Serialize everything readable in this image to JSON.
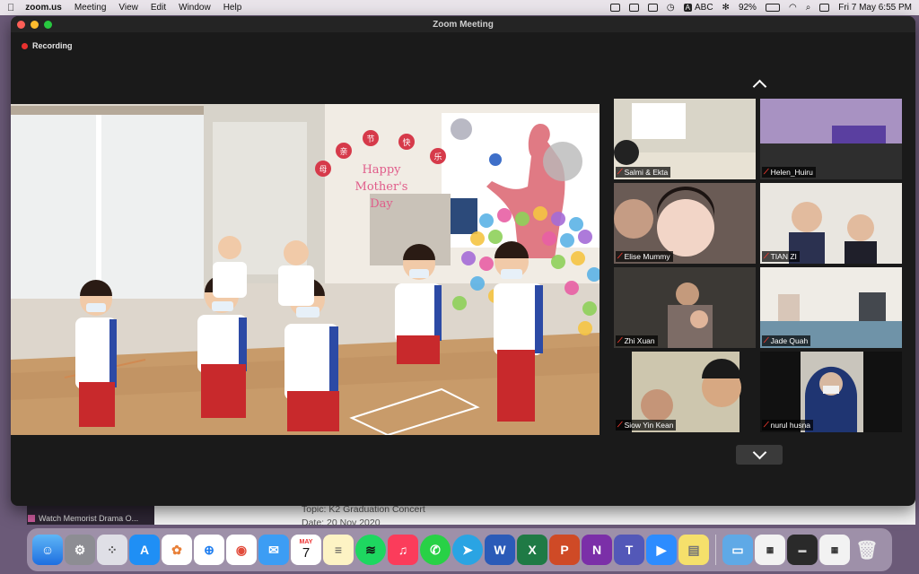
{
  "menubar": {
    "app": "zoom.us",
    "items": [
      "Meeting",
      "View",
      "Edit",
      "Window",
      "Help"
    ],
    "input_source": "ABC",
    "battery": "92%",
    "datetime": "Fri 7 May  6:55 PM"
  },
  "window": {
    "title": "Zoom Meeting",
    "recording_label": "Recording"
  },
  "main_video": {
    "banner": "Happy Mother's Day",
    "chinese_title": [
      "母",
      "亲",
      "节",
      "快",
      "乐"
    ]
  },
  "participants": [
    {
      "name": "Salmi & Ekta",
      "muted": true
    },
    {
      "name": "Helen_Huiru",
      "muted": true
    },
    {
      "name": "Elise Mummy",
      "muted": true
    },
    {
      "name": "TIAN ZI",
      "muted": true
    },
    {
      "name": "Zhi Xuan",
      "muted": true
    },
    {
      "name": "Jade Quah",
      "muted": true
    },
    {
      "name": "Siow Yin Kean",
      "muted": true
    },
    {
      "name": "nurul husna",
      "muted": true
    }
  ],
  "background_window": {
    "sidebar_item": "Watch Memorist Drama O...",
    "topic_line": "Topic: K2 Graduation Concert",
    "date_line": "Date: 20 Nov 2020"
  },
  "dock": {
    "apps": [
      "Finder",
      "System Preferences",
      "Launchpad",
      "App Store",
      "Photos",
      "Safari",
      "Chrome",
      "Mail",
      "Calendar",
      "Notes",
      "Spotify",
      "Music",
      "WhatsApp",
      "Telegram",
      "Word",
      "Excel",
      "PowerPoint",
      "OneNote",
      "Teams",
      "Zoom",
      "Stickies"
    ],
    "calendar_month": "MAY",
    "calendar_day": "7"
  }
}
